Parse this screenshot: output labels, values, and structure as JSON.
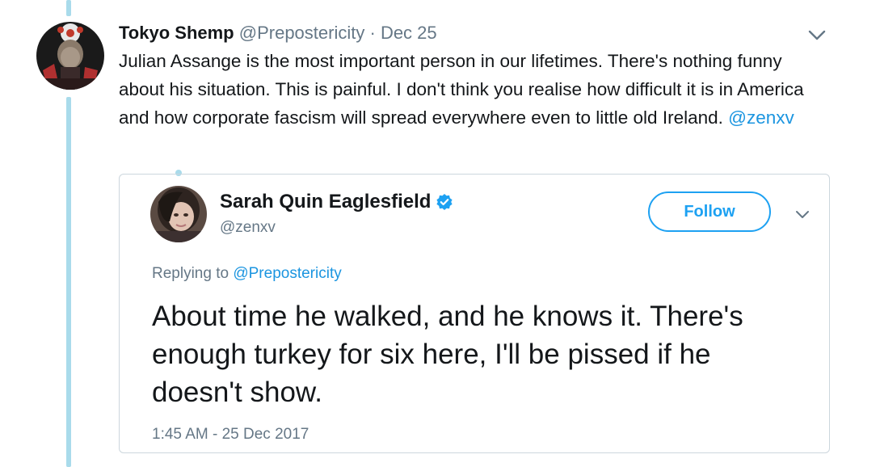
{
  "tweet": {
    "author_name": "Tokyo Shemp",
    "author_handle": "@Prepostericity",
    "separator": "·",
    "date": "Dec 25",
    "text": "Julian Assange is the most important person in our lifetimes. There's nothing funny about his situation. This is painful. I don't think you realise how difficult it is in America and how corporate fascism will spread everywhere even to little old Ireland.",
    "mention": "@zenxv",
    "avatar_icon": "profile-photo",
    "menu_icon": "chevron-down-icon"
  },
  "quoted_tweet": {
    "author_name": "Sarah Quin Eaglesfield",
    "verified_icon": "verified-badge-icon",
    "author_handle": "@zenxv",
    "follow_label": "Follow",
    "replying_prefix": "Replying to",
    "replying_to": "@Prepostericity",
    "text": "About time he walked, and he knows it. There's enough turkey for six here, I'll be pissed if he doesn't show.",
    "timestamp": "1:45 AM - 25 Dec 2017"
  },
  "colors": {
    "accent": "#1da1f2",
    "link": "#1b95e0",
    "muted_text": "#657786",
    "thread_line": "#a9dbeb",
    "border": "#ccd6dd"
  }
}
